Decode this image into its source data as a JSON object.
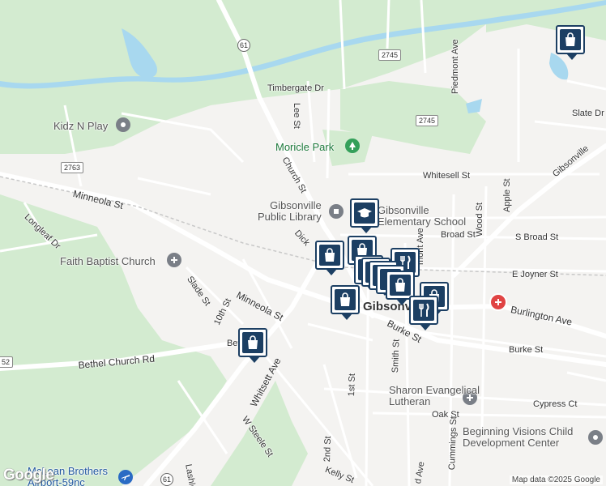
{
  "map": {
    "places": [
      {
        "id": "moricle-park",
        "label": "Moricle Park",
        "kind": "park"
      },
      {
        "id": "kidz-n-play",
        "label": "Kidz N Play",
        "kind": "grey"
      },
      {
        "id": "library",
        "label": "Gibsonville\nPublic Library",
        "kind": "grey"
      },
      {
        "id": "elementary",
        "label": "Gibsonville\nElementary School",
        "kind": "grey"
      },
      {
        "id": "faith-baptist",
        "label": "Faith Baptist Church",
        "kind": "grey"
      },
      {
        "id": "sharon",
        "label": "Sharon Evangelical\nLutheran",
        "kind": "grey"
      },
      {
        "id": "beginning-visions",
        "label": "Beginning Visions Child\nDevelopment Center",
        "kind": "grey"
      },
      {
        "id": "airport",
        "label": "McLean Brothers\nAirport-59nc",
        "kind": "blue"
      },
      {
        "id": "city",
        "label": "Gibsonville",
        "kind": "city"
      }
    ],
    "streets": {
      "timbergate": "Timbergate Dr",
      "lee": "Lee St",
      "piedmont": "Piedmont Ave",
      "slate": "Slate Dr",
      "gibsonville_partial": "Gibsonville",
      "church": "Church St",
      "whitesell": "Whitesell St",
      "minneola_1": "Minneola St",
      "minneola_2": "Minneola St",
      "longleaf": "Longleaf Dr",
      "apple": "Apple St",
      "wood": "Wood St",
      "broad": "Broad St",
      "s_broad": "S Broad St",
      "dick": "Dick",
      "mont": "mont Ave",
      "e_joyner": "E Joyner St",
      "burlington": "Burlington Ave",
      "burke_1": "Burke St",
      "burke_2": "Burke St",
      "slade": "Slade St",
      "tenth": "10th St",
      "bethel_church": "Bethel Church Rd",
      "bet": "Bet",
      "whitsett": "Whitsett Ave",
      "smith": "Smith St",
      "first": "1st St",
      "cypress": "Cypress Ct",
      "oak": "Oak St",
      "cummings": "Cummings St",
      "w_steele": "W Steele St",
      "second": "2nd St",
      "kelly": "Kelly St",
      "lash": "Lashle",
      "d_ave": "d Ave"
    },
    "shields": {
      "r61_top": "61",
      "r2745_a": "2745",
      "r2745_b": "2745",
      "r2763": "2763",
      "r52": "52",
      "r61_bottom": "61"
    },
    "markers": [
      {
        "id": "m1",
        "type": "shopping"
      },
      {
        "id": "m2",
        "type": "school"
      },
      {
        "id": "m3",
        "type": "shopping"
      },
      {
        "id": "m4",
        "type": "shopping"
      },
      {
        "id": "m5",
        "type": "restaurant"
      },
      {
        "id": "m6",
        "type": "shopping"
      },
      {
        "id": "m7",
        "type": "shopping"
      },
      {
        "id": "m8",
        "type": "shopping"
      },
      {
        "id": "m9",
        "type": "shopping"
      },
      {
        "id": "m10",
        "type": "shopping"
      },
      {
        "id": "m11",
        "type": "shopping"
      },
      {
        "id": "m12",
        "type": "restaurant"
      },
      {
        "id": "m13",
        "type": "shopping"
      }
    ],
    "attribution": "Map data ©2025 Google",
    "logo": "Google",
    "colors": {
      "land": "#f4f3f1",
      "green": "#d3ebd0",
      "water": "#a8d8ef",
      "marker": "#1c3f63"
    }
  }
}
